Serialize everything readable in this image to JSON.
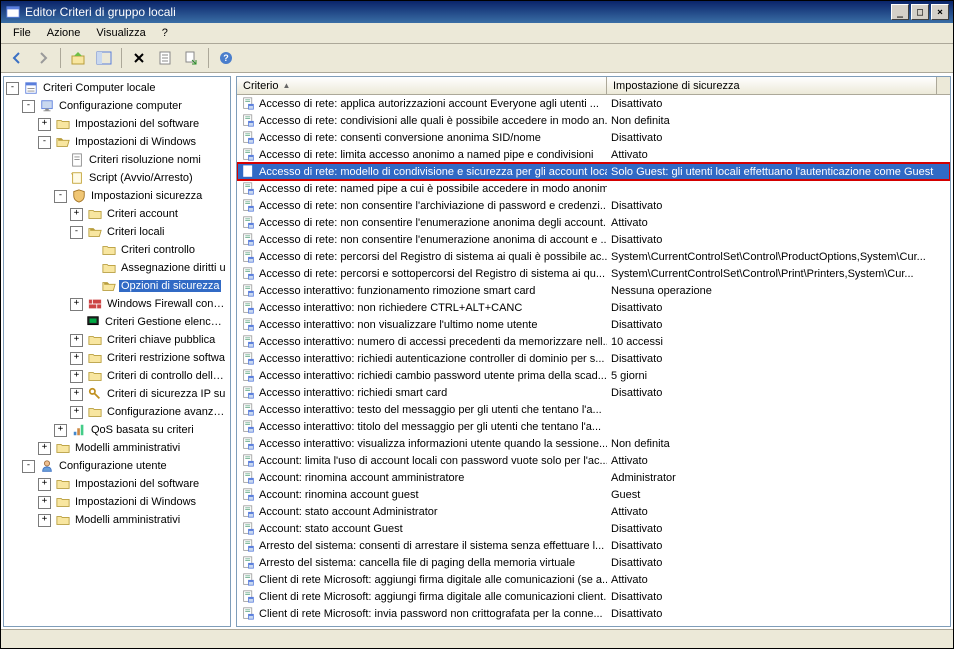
{
  "window": {
    "title": "Editor Criteri di gruppo locali"
  },
  "menu": {
    "file": "File",
    "azione": "Azione",
    "visualizza": "Visualizza",
    "help": "?"
  },
  "columns": {
    "criterio": "Criterio",
    "impostazione": "Impostazione di sicurezza"
  },
  "tree": {
    "root": "Criteri Computer locale",
    "cfg_computer": "Configurazione computer",
    "sw_settings": "Impostazioni del software",
    "win_settings": "Impostazioni di Windows",
    "name_res": "Criteri risoluzione nomi",
    "scripts": "Script (Avvio/Arresto)",
    "sec_settings": "Impostazioni sicurezza",
    "account_pol": "Criteri account",
    "local_pol": "Criteri locali",
    "audit_pol": "Criteri controllo",
    "user_rights": "Assegnazione diritti u",
    "sec_options": "Opzioni di sicurezza",
    "firewall": "Windows Firewall con sic",
    "nlm": "Criteri Gestione elenco re",
    "pubkey": "Criteri chiave pubblica",
    "sw_restrict": "Criteri restrizione softwa",
    "app_control": "Criteri di controllo delle a",
    "ipsec": "Criteri di sicurezza IP su",
    "adv_audit": "Configurazione avanzata",
    "qos": "QoS basata su criteri",
    "admin_templates": "Modelli amministrativi",
    "cfg_user": "Configurazione utente",
    "sw_settings_u": "Impostazioni del software",
    "win_settings_u": "Impostazioni di Windows",
    "admin_templates_u": "Modelli amministrativi"
  },
  "policies": [
    {
      "name": "Accesso di rete: applica autorizzazioni account Everyone agli utenti ...",
      "val": "Disattivato"
    },
    {
      "name": "Accesso di rete: condivisioni alle quali è possibile accedere in modo an...",
      "val": "Non definita"
    },
    {
      "name": "Accesso di rete: consenti conversione anonima SID/nome",
      "val": "Disattivato"
    },
    {
      "name": "Accesso di rete: limita accesso anonimo a named pipe e condivisioni",
      "val": "Attivato"
    },
    {
      "name": "Accesso di rete: modello di condivisione e sicurezza per gli account locali",
      "val": "Solo Guest: gli utenti locali effettuano l'autenticazione come Guest",
      "selected": true,
      "highlighted": true
    },
    {
      "name": "Accesso di rete: named pipe a cui è possibile accedere in modo anonimo",
      "val": ""
    },
    {
      "name": "Accesso di rete: non consentire l'archiviazione di password e credenzi...",
      "val": "Disattivato"
    },
    {
      "name": "Accesso di rete: non consentire l'enumerazione anonima degli account...",
      "val": "Attivato"
    },
    {
      "name": "Accesso di rete: non consentire l'enumerazione anonima di account e ...",
      "val": "Disattivato"
    },
    {
      "name": "Accesso di rete: percorsi del Registro di sistema ai quali è possibile ac...",
      "val": "System\\CurrentControlSet\\Control\\ProductOptions,System\\Cur..."
    },
    {
      "name": "Accesso di rete: percorsi e sottopercorsi del Registro di sistema ai qu...",
      "val": "System\\CurrentControlSet\\Control\\Print\\Printers,System\\Cur..."
    },
    {
      "name": "Accesso interattivo: funzionamento rimozione smart card",
      "val": "Nessuna operazione"
    },
    {
      "name": "Accesso interattivo: non richiedere CTRL+ALT+CANC",
      "val": "Disattivato"
    },
    {
      "name": "Accesso interattivo: non visualizzare l'ultimo nome utente",
      "val": "Disattivato"
    },
    {
      "name": "Accesso interattivo: numero di accessi precedenti da memorizzare nell...",
      "val": "10 accessi"
    },
    {
      "name": "Accesso interattivo: richiedi autenticazione controller di dominio per s...",
      "val": "Disattivato"
    },
    {
      "name": "Accesso interattivo: richiedi cambio password utente prima della scad...",
      "val": "5 giorni"
    },
    {
      "name": "Accesso interattivo: richiedi smart card",
      "val": "Disattivato"
    },
    {
      "name": "Accesso interattivo: testo del messaggio per gli utenti che tentano l'a...",
      "val": ""
    },
    {
      "name": "Accesso interattivo: titolo del messaggio per gli utenti che tentano l'a...",
      "val": ""
    },
    {
      "name": "Accesso interattivo: visualizza informazioni utente quando la sessione...",
      "val": "Non definita"
    },
    {
      "name": "Account: limita l'uso di account locali con password vuote solo per l'ac...",
      "val": "Attivato"
    },
    {
      "name": "Account: rinomina account amministratore",
      "val": "Administrator"
    },
    {
      "name": "Account: rinomina account guest",
      "val": "Guest"
    },
    {
      "name": "Account: stato account Administrator",
      "val": "Attivato"
    },
    {
      "name": "Account: stato account Guest",
      "val": "Disattivato"
    },
    {
      "name": "Arresto del sistema: consenti di arrestare il sistema senza effettuare l...",
      "val": "Disattivato"
    },
    {
      "name": "Arresto del sistema: cancella file di paging della memoria virtuale",
      "val": "Disattivato"
    },
    {
      "name": "Client di rete Microsoft: aggiungi firma digitale alle comunicazioni (se a...",
      "val": "Attivato"
    },
    {
      "name": "Client di rete Microsoft: aggiungi firma digitale alle comunicazioni client...",
      "val": "Disattivato"
    },
    {
      "name": "Client di rete Microsoft: invia password non crittografata per la conne...",
      "val": "Disattivato"
    }
  ]
}
